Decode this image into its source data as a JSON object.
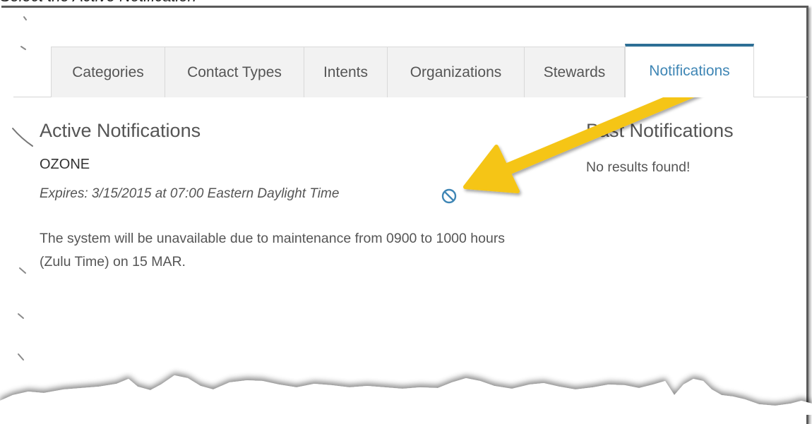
{
  "caption": "Select the Active Notification",
  "tabs": [
    {
      "label": "Categories",
      "active": false
    },
    {
      "label": "Contact Types",
      "active": false
    },
    {
      "label": "Intents",
      "active": false
    },
    {
      "label": "Organizations",
      "active": false
    },
    {
      "label": "Stewards",
      "active": false
    },
    {
      "label": "Notifications",
      "active": true
    }
  ],
  "active_notifications": {
    "title": "Active Notifications",
    "items": [
      {
        "name": "OZONE",
        "expires": "Expires: 3/15/2015 at 07:00 Eastern Daylight Time",
        "action_icon": "deactivate-icon",
        "message": "The system will be unavailable due to maintenance from 0900 to 1000 hours (Zulu Time) on 15 MAR."
      }
    ]
  },
  "past_notifications": {
    "title": "Past Notifications",
    "empty_text": "No results found!"
  },
  "colors": {
    "accent": "#2d6f95",
    "active_tab_text": "#3f86b5",
    "icon": "#3f86b5",
    "callout_arrow": "#f5c518",
    "tab_bg": "#f2f2f2",
    "text": "#555555"
  }
}
